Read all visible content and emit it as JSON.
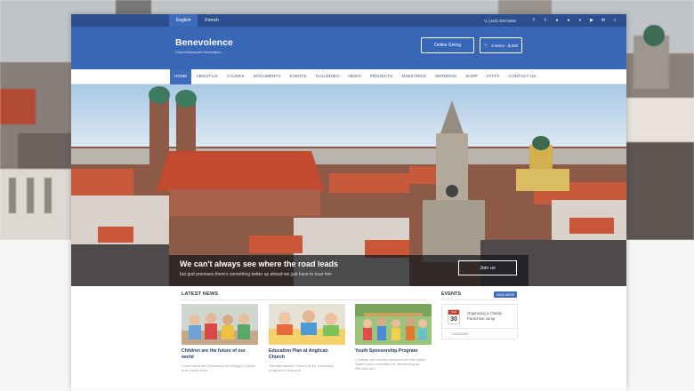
{
  "topbar": {
    "languages": [
      "English",
      "French"
    ],
    "phone": "+1 (444) 000-0000",
    "social_icons": [
      "facebook-icon",
      "twitter-icon",
      "pinterest-icon",
      "google-plus-icon",
      "vimeo-icon",
      "youtube-icon",
      "email-icon",
      "search-icon"
    ]
  },
  "header": {
    "brand": "Benevolence",
    "tagline": "Church/Nonprofit Association",
    "giving_label": "Online Giving",
    "cart_label": "0 items - $.000"
  },
  "nav": {
    "items": [
      "HOME",
      "ABOUT US",
      "CAUSES",
      "DOCUMENTS",
      "EVENTS",
      "GALLERIES",
      "NEWS",
      "PROJECTS",
      "MINISTRIES",
      "SERMONS",
      "SHOP",
      "STAFF",
      "CONTACT US"
    ],
    "active": "HOME"
  },
  "hero": {
    "title": "We can't always see where the road leads",
    "subtitle": "but god promises there's something better up ahead we just have to trust him",
    "button_label": "Join us"
  },
  "latest_news": {
    "heading": "LATEST NEWS",
    "cards": [
      {
        "title": "Children are the future of our world",
        "text": "Lorem when the Sanctuary in Kellogg's Capitol is so much more"
      },
      {
        "title": "Education Plan at Anglican Church",
        "text": "The affectionate Church of the Sanctuary program to strong at"
      },
      {
        "title": "Youth Sponsorship Program",
        "text": "Christian and Jewish leaders from the United States have committed to \"developing an effective and"
      }
    ]
  },
  "events": {
    "heading": "EVENTS",
    "view_more": "VIEW MORE",
    "items": [
      {
        "month": "JUN",
        "day": "30",
        "title": "Organising a Charity Parachute Jump"
      }
    ],
    "calendar_label": "CALENDAR"
  },
  "colors": {
    "topbar": "#2d4f8f",
    "header": "#3867b8",
    "accent": "#3f6cba",
    "calendar_red": "#c83a2a"
  }
}
